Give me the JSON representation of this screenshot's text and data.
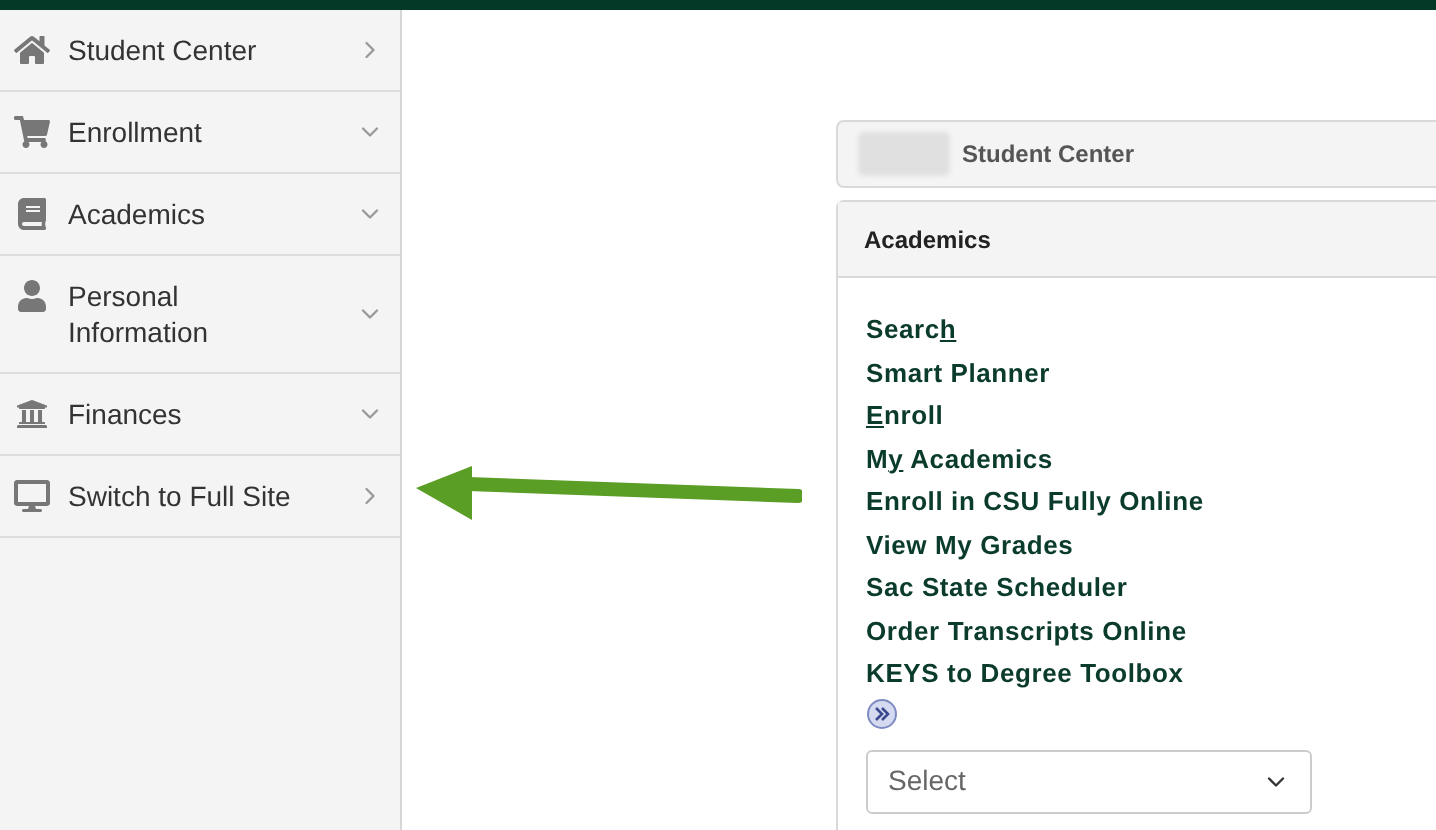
{
  "sidebar": {
    "items": [
      {
        "label": "Student Center",
        "kind": "link"
      },
      {
        "label": "Enrollment",
        "kind": "group"
      },
      {
        "label": "Academics",
        "kind": "group"
      },
      {
        "label": "Personal Information",
        "kind": "group"
      },
      {
        "label": "Finances",
        "kind": "group"
      },
      {
        "label": "Switch to Full Site",
        "kind": "link"
      }
    ]
  },
  "breadcrumb": {
    "title": "Student Center"
  },
  "panel": {
    "title": "Academics",
    "links": [
      {
        "before": "Searc",
        "accesskey": "h"
      },
      {
        "before": "Smart Planner"
      },
      {
        "accesskey": "E",
        "after": "nroll"
      },
      {
        "before": "M",
        "accesskey": "y",
        "after": " Academics"
      },
      {
        "before": "Enroll in CSU Fully Online"
      },
      {
        "before": "View My Grades"
      },
      {
        "before": "Sac State Scheduler"
      },
      {
        "before": "Order Transcripts Online"
      },
      {
        "before": "KEYS to Degree Toolbox"
      }
    ],
    "select": {
      "placeholder": "Select"
    }
  }
}
